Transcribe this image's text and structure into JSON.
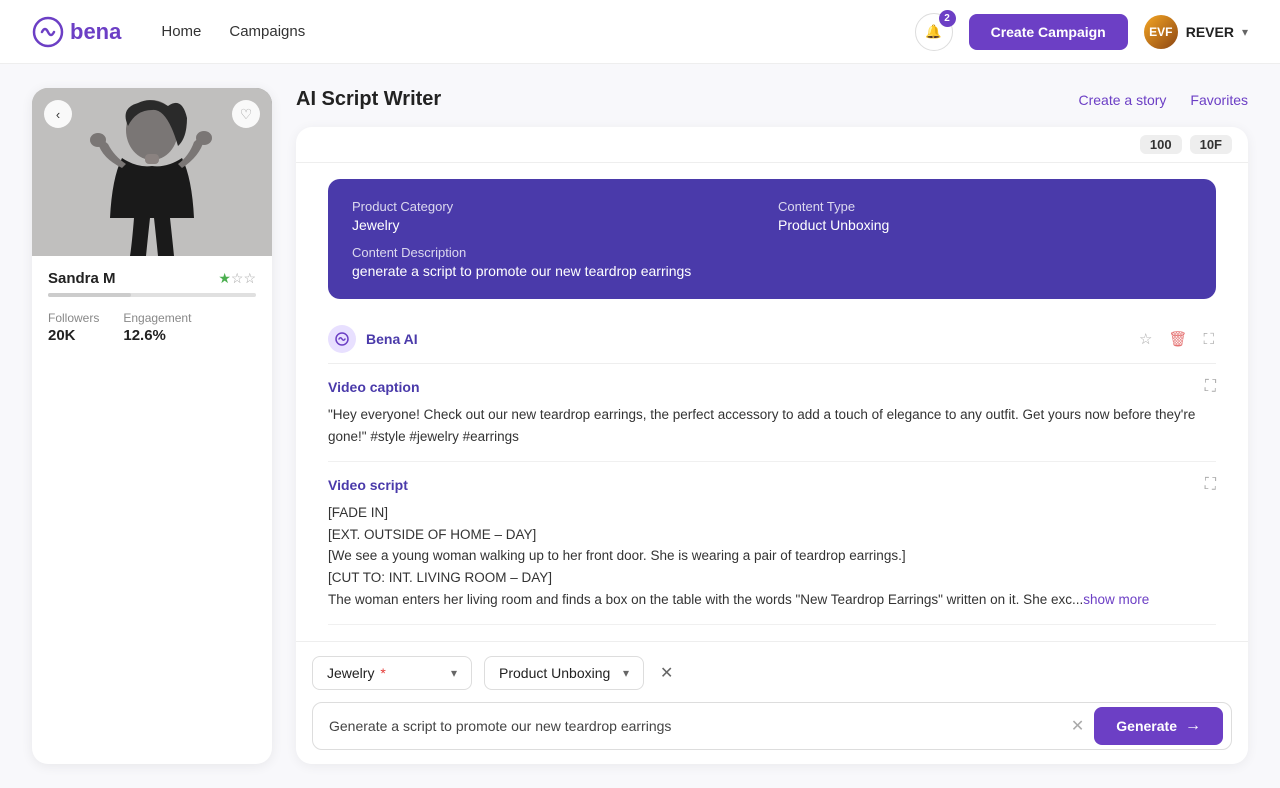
{
  "app": {
    "logo_text": "bena",
    "nav": {
      "links": [
        "Home",
        "Campaigns"
      ],
      "notif_count": "2",
      "create_campaign": "Create Campaign",
      "user_initials": "EVF",
      "user_name": "REVER"
    }
  },
  "profile": {
    "name": "Sandra M",
    "followers_label": "Followers",
    "followers_value": "20K",
    "engagement_label": "Engagement",
    "engagement_value": "12.6%",
    "stars_total": 3,
    "stars_filled": 1
  },
  "script_writer": {
    "title": "AI Script Writer",
    "create_story": "Create a story",
    "favorites": "Favorites",
    "count_1": "100",
    "count_2": "10F"
  },
  "info_block": {
    "product_category_label": "Product Category",
    "product_category_value": "Jewelry",
    "content_type_label": "Content Type",
    "content_type_value": "Product Unboxing",
    "content_description_label": "Content Description",
    "content_description_value": "generate a script to promote our new teardrop earrings"
  },
  "ai_message": {
    "ai_name": "Bena AI",
    "video_caption_title": "Video caption",
    "video_caption_text": "\"Hey everyone! Check out our new teardrop earrings, the perfect accessory to add a touch of elegance to any outfit. Get yours now before they're gone!\" #style #jewelry #earrings",
    "video_script_title": "Video script",
    "video_script_text": "[FADE IN]\n[EXT. OUTSIDE OF HOME – DAY]\n[We see a young woman walking up to her front door. She is wearing a pair of teardrop earrings.]\n[CUT TO: INT. LIVING ROOM – DAY]\nThe woman enters her living room and finds a box on the table with the words \"New Teardrop Earrings\" written on it. She exc...",
    "show_more": "show more"
  },
  "bottom_bar": {
    "dropdown1_label": "Jewelry",
    "dropdown1_required": true,
    "dropdown2_label": "Product Unboxing",
    "input_placeholder": "Generate a script to promote our new teardrop earrings",
    "generate_label": "Generate"
  }
}
